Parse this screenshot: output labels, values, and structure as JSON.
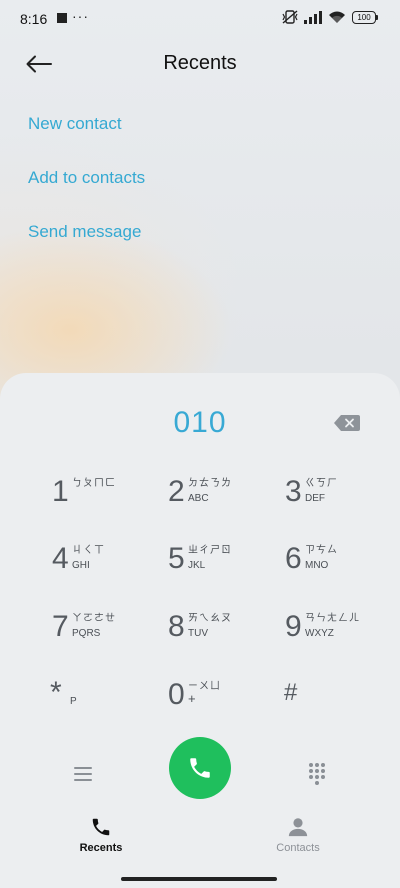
{
  "status_bar": {
    "time": "8:16",
    "dots": "···",
    "battery": "100"
  },
  "header": {
    "title": "Recents"
  },
  "actions": {
    "new_contact": "New contact",
    "add_to_contacts": "Add to contacts",
    "send_message": "Send message"
  },
  "dialer": {
    "number": "010",
    "keys": [
      {
        "digit": "1",
        "sub": "ㄅㄆㄇㄈ",
        "letters": ""
      },
      {
        "digit": "2",
        "sub": "ㄉㄊㄋㄌ",
        "letters": "ABC"
      },
      {
        "digit": "3",
        "sub": "ㄍㄎㄏ",
        "letters": "DEF"
      },
      {
        "digit": "4",
        "sub": "ㄐㄑㄒ",
        "letters": "GHI"
      },
      {
        "digit": "5",
        "sub": "ㄓㄔㄕㄖ",
        "letters": "JKL"
      },
      {
        "digit": "6",
        "sub": "ㄗㄘㄙ",
        "letters": "MNO"
      },
      {
        "digit": "7",
        "sub": "ㄚㄛㄜㄝ",
        "letters": "PQRS"
      },
      {
        "digit": "8",
        "sub": "ㄞㄟㄠㄡ",
        "letters": "TUV"
      },
      {
        "digit": "9",
        "sub": "ㄢㄣㄤㄥㄦ",
        "letters": "WXYZ"
      },
      {
        "digit": "*",
        "sub": "",
        "letters": "P"
      },
      {
        "digit": "0",
        "sub": "ㄧㄨㄩ",
        "letters": "+"
      },
      {
        "digit": "#",
        "sub": "",
        "letters": ""
      }
    ]
  },
  "nav": {
    "recents": "Recents",
    "contacts": "Contacts"
  },
  "colors": {
    "accent": "#35a9d2",
    "call": "#1fbf5d"
  }
}
